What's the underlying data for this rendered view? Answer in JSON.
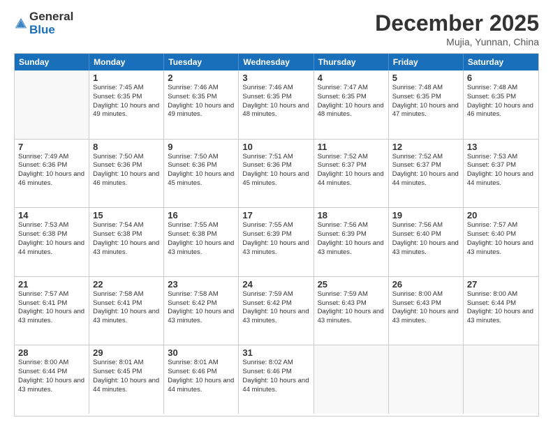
{
  "header": {
    "logo_general": "General",
    "logo_blue": "Blue",
    "month_title": "December 2025",
    "location": "Mujia, Yunnan, China"
  },
  "weekdays": [
    "Sunday",
    "Monday",
    "Tuesday",
    "Wednesday",
    "Thursday",
    "Friday",
    "Saturday"
  ],
  "rows": [
    [
      {
        "day": "",
        "empty": true
      },
      {
        "day": "1",
        "sunrise": "7:45 AM",
        "sunset": "6:35 PM",
        "daylight": "10 hours and 49 minutes."
      },
      {
        "day": "2",
        "sunrise": "7:46 AM",
        "sunset": "6:35 PM",
        "daylight": "10 hours and 49 minutes."
      },
      {
        "day": "3",
        "sunrise": "7:46 AM",
        "sunset": "6:35 PM",
        "daylight": "10 hours and 48 minutes."
      },
      {
        "day": "4",
        "sunrise": "7:47 AM",
        "sunset": "6:35 PM",
        "daylight": "10 hours and 48 minutes."
      },
      {
        "day": "5",
        "sunrise": "7:48 AM",
        "sunset": "6:35 PM",
        "daylight": "10 hours and 47 minutes."
      },
      {
        "day": "6",
        "sunrise": "7:48 AM",
        "sunset": "6:35 PM",
        "daylight": "10 hours and 46 minutes."
      }
    ],
    [
      {
        "day": "7",
        "sunrise": "7:49 AM",
        "sunset": "6:36 PM",
        "daylight": "10 hours and 46 minutes."
      },
      {
        "day": "8",
        "sunrise": "7:50 AM",
        "sunset": "6:36 PM",
        "daylight": "10 hours and 46 minutes."
      },
      {
        "day": "9",
        "sunrise": "7:50 AM",
        "sunset": "6:36 PM",
        "daylight": "10 hours and 45 minutes."
      },
      {
        "day": "10",
        "sunrise": "7:51 AM",
        "sunset": "6:36 PM",
        "daylight": "10 hours and 45 minutes."
      },
      {
        "day": "11",
        "sunrise": "7:52 AM",
        "sunset": "6:37 PM",
        "daylight": "10 hours and 44 minutes."
      },
      {
        "day": "12",
        "sunrise": "7:52 AM",
        "sunset": "6:37 PM",
        "daylight": "10 hours and 44 minutes."
      },
      {
        "day": "13",
        "sunrise": "7:53 AM",
        "sunset": "6:37 PM",
        "daylight": "10 hours and 44 minutes."
      }
    ],
    [
      {
        "day": "14",
        "sunrise": "7:53 AM",
        "sunset": "6:38 PM",
        "daylight": "10 hours and 44 minutes."
      },
      {
        "day": "15",
        "sunrise": "7:54 AM",
        "sunset": "6:38 PM",
        "daylight": "10 hours and 43 minutes."
      },
      {
        "day": "16",
        "sunrise": "7:55 AM",
        "sunset": "6:38 PM",
        "daylight": "10 hours and 43 minutes."
      },
      {
        "day": "17",
        "sunrise": "7:55 AM",
        "sunset": "6:39 PM",
        "daylight": "10 hours and 43 minutes."
      },
      {
        "day": "18",
        "sunrise": "7:56 AM",
        "sunset": "6:39 PM",
        "daylight": "10 hours and 43 minutes."
      },
      {
        "day": "19",
        "sunrise": "7:56 AM",
        "sunset": "6:40 PM",
        "daylight": "10 hours and 43 minutes."
      },
      {
        "day": "20",
        "sunrise": "7:57 AM",
        "sunset": "6:40 PM",
        "daylight": "10 hours and 43 minutes."
      }
    ],
    [
      {
        "day": "21",
        "sunrise": "7:57 AM",
        "sunset": "6:41 PM",
        "daylight": "10 hours and 43 minutes."
      },
      {
        "day": "22",
        "sunrise": "7:58 AM",
        "sunset": "6:41 PM",
        "daylight": "10 hours and 43 minutes."
      },
      {
        "day": "23",
        "sunrise": "7:58 AM",
        "sunset": "6:42 PM",
        "daylight": "10 hours and 43 minutes."
      },
      {
        "day": "24",
        "sunrise": "7:59 AM",
        "sunset": "6:42 PM",
        "daylight": "10 hours and 43 minutes."
      },
      {
        "day": "25",
        "sunrise": "7:59 AM",
        "sunset": "6:43 PM",
        "daylight": "10 hours and 43 minutes."
      },
      {
        "day": "26",
        "sunrise": "8:00 AM",
        "sunset": "6:43 PM",
        "daylight": "10 hours and 43 minutes."
      },
      {
        "day": "27",
        "sunrise": "8:00 AM",
        "sunset": "6:44 PM",
        "daylight": "10 hours and 43 minutes."
      }
    ],
    [
      {
        "day": "28",
        "sunrise": "8:00 AM",
        "sunset": "6:44 PM",
        "daylight": "10 hours and 43 minutes."
      },
      {
        "day": "29",
        "sunrise": "8:01 AM",
        "sunset": "6:45 PM",
        "daylight": "10 hours and 44 minutes."
      },
      {
        "day": "30",
        "sunrise": "8:01 AM",
        "sunset": "6:46 PM",
        "daylight": "10 hours and 44 minutes."
      },
      {
        "day": "31",
        "sunrise": "8:02 AM",
        "sunset": "6:46 PM",
        "daylight": "10 hours and 44 minutes."
      },
      {
        "day": "",
        "empty": true
      },
      {
        "day": "",
        "empty": true
      },
      {
        "day": "",
        "empty": true
      }
    ]
  ]
}
